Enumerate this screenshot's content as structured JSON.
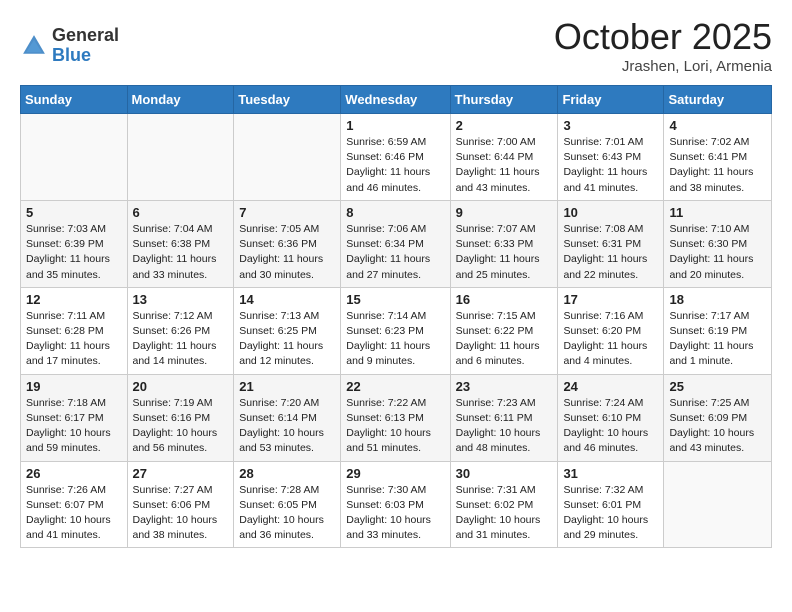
{
  "header": {
    "logo_general": "General",
    "logo_blue": "Blue",
    "title": "October 2025",
    "location": "Jrashen, Lori, Armenia"
  },
  "weekdays": [
    "Sunday",
    "Monday",
    "Tuesday",
    "Wednesday",
    "Thursday",
    "Friday",
    "Saturday"
  ],
  "weeks": [
    [
      {
        "day": "",
        "info": ""
      },
      {
        "day": "",
        "info": ""
      },
      {
        "day": "",
        "info": ""
      },
      {
        "day": "1",
        "info": "Sunrise: 6:59 AM\nSunset: 6:46 PM\nDaylight: 11 hours\nand 46 minutes."
      },
      {
        "day": "2",
        "info": "Sunrise: 7:00 AM\nSunset: 6:44 PM\nDaylight: 11 hours\nand 43 minutes."
      },
      {
        "day": "3",
        "info": "Sunrise: 7:01 AM\nSunset: 6:43 PM\nDaylight: 11 hours\nand 41 minutes."
      },
      {
        "day": "4",
        "info": "Sunrise: 7:02 AM\nSunset: 6:41 PM\nDaylight: 11 hours\nand 38 minutes."
      }
    ],
    [
      {
        "day": "5",
        "info": "Sunrise: 7:03 AM\nSunset: 6:39 PM\nDaylight: 11 hours\nand 35 minutes."
      },
      {
        "day": "6",
        "info": "Sunrise: 7:04 AM\nSunset: 6:38 PM\nDaylight: 11 hours\nand 33 minutes."
      },
      {
        "day": "7",
        "info": "Sunrise: 7:05 AM\nSunset: 6:36 PM\nDaylight: 11 hours\nand 30 minutes."
      },
      {
        "day": "8",
        "info": "Sunrise: 7:06 AM\nSunset: 6:34 PM\nDaylight: 11 hours\nand 27 minutes."
      },
      {
        "day": "9",
        "info": "Sunrise: 7:07 AM\nSunset: 6:33 PM\nDaylight: 11 hours\nand 25 minutes."
      },
      {
        "day": "10",
        "info": "Sunrise: 7:08 AM\nSunset: 6:31 PM\nDaylight: 11 hours\nand 22 minutes."
      },
      {
        "day": "11",
        "info": "Sunrise: 7:10 AM\nSunset: 6:30 PM\nDaylight: 11 hours\nand 20 minutes."
      }
    ],
    [
      {
        "day": "12",
        "info": "Sunrise: 7:11 AM\nSunset: 6:28 PM\nDaylight: 11 hours\nand 17 minutes."
      },
      {
        "day": "13",
        "info": "Sunrise: 7:12 AM\nSunset: 6:26 PM\nDaylight: 11 hours\nand 14 minutes."
      },
      {
        "day": "14",
        "info": "Sunrise: 7:13 AM\nSunset: 6:25 PM\nDaylight: 11 hours\nand 12 minutes."
      },
      {
        "day": "15",
        "info": "Sunrise: 7:14 AM\nSunset: 6:23 PM\nDaylight: 11 hours\nand 9 minutes."
      },
      {
        "day": "16",
        "info": "Sunrise: 7:15 AM\nSunset: 6:22 PM\nDaylight: 11 hours\nand 6 minutes."
      },
      {
        "day": "17",
        "info": "Sunrise: 7:16 AM\nSunset: 6:20 PM\nDaylight: 11 hours\nand 4 minutes."
      },
      {
        "day": "18",
        "info": "Sunrise: 7:17 AM\nSunset: 6:19 PM\nDaylight: 11 hours\nand 1 minute."
      }
    ],
    [
      {
        "day": "19",
        "info": "Sunrise: 7:18 AM\nSunset: 6:17 PM\nDaylight: 10 hours\nand 59 minutes."
      },
      {
        "day": "20",
        "info": "Sunrise: 7:19 AM\nSunset: 6:16 PM\nDaylight: 10 hours\nand 56 minutes."
      },
      {
        "day": "21",
        "info": "Sunrise: 7:20 AM\nSunset: 6:14 PM\nDaylight: 10 hours\nand 53 minutes."
      },
      {
        "day": "22",
        "info": "Sunrise: 7:22 AM\nSunset: 6:13 PM\nDaylight: 10 hours\nand 51 minutes."
      },
      {
        "day": "23",
        "info": "Sunrise: 7:23 AM\nSunset: 6:11 PM\nDaylight: 10 hours\nand 48 minutes."
      },
      {
        "day": "24",
        "info": "Sunrise: 7:24 AM\nSunset: 6:10 PM\nDaylight: 10 hours\nand 46 minutes."
      },
      {
        "day": "25",
        "info": "Sunrise: 7:25 AM\nSunset: 6:09 PM\nDaylight: 10 hours\nand 43 minutes."
      }
    ],
    [
      {
        "day": "26",
        "info": "Sunrise: 7:26 AM\nSunset: 6:07 PM\nDaylight: 10 hours\nand 41 minutes."
      },
      {
        "day": "27",
        "info": "Sunrise: 7:27 AM\nSunset: 6:06 PM\nDaylight: 10 hours\nand 38 minutes."
      },
      {
        "day": "28",
        "info": "Sunrise: 7:28 AM\nSunset: 6:05 PM\nDaylight: 10 hours\nand 36 minutes."
      },
      {
        "day": "29",
        "info": "Sunrise: 7:30 AM\nSunset: 6:03 PM\nDaylight: 10 hours\nand 33 minutes."
      },
      {
        "day": "30",
        "info": "Sunrise: 7:31 AM\nSunset: 6:02 PM\nDaylight: 10 hours\nand 31 minutes."
      },
      {
        "day": "31",
        "info": "Sunrise: 7:32 AM\nSunset: 6:01 PM\nDaylight: 10 hours\nand 29 minutes."
      },
      {
        "day": "",
        "info": ""
      }
    ]
  ]
}
